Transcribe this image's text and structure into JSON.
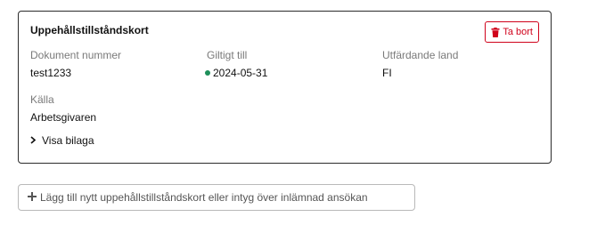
{
  "card": {
    "title": "Uppehållstillståndskort",
    "delete_label": "Ta bort",
    "delete_icon": "trash-icon",
    "fields": {
      "doc_number_label": "Dokument nummer",
      "doc_number_value": "test1233",
      "valid_until_label": "Giltigt till",
      "valid_until_value": "2024-05-31",
      "country_label": "Utfärdande land",
      "country_value": "FI",
      "source_label": "Källa",
      "source_value": "Arbetsgivaren"
    },
    "show_attachment_label": "Visa bilaga",
    "show_attachment_icon": "chevron-right-icon"
  },
  "add_button": {
    "label": "Lägg till nytt uppehållstillståndskort eller intyg över inlämnad ansökan",
    "icon": "plus-icon"
  },
  "colors": {
    "danger": "#d0021b",
    "valid_dot": "#1e8f5a",
    "border": "#2b2b2b"
  }
}
